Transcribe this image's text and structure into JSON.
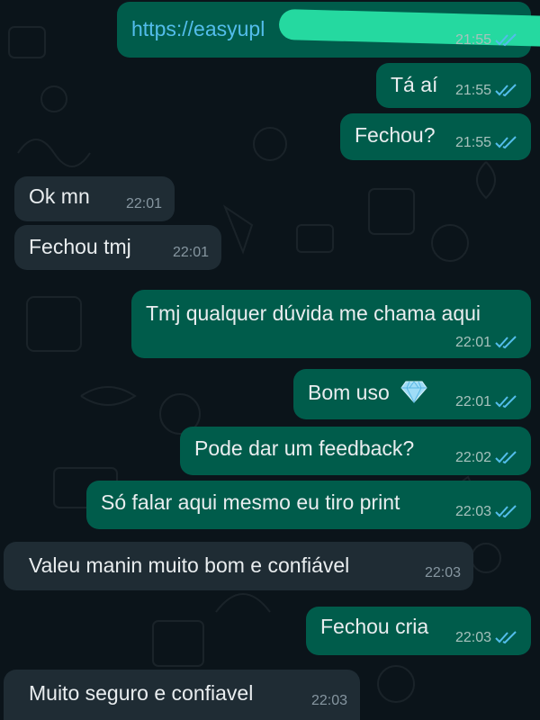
{
  "chat": {
    "messages": [
      {
        "direction": "outgoing",
        "text": "https://easyupl",
        "time": "21:55",
        "status": "read",
        "link": true,
        "redacted": true
      },
      {
        "direction": "outgoing",
        "text": "Tá aí",
        "time": "21:55",
        "status": "read"
      },
      {
        "direction": "outgoing",
        "text": "Fechou?",
        "time": "21:55",
        "status": "read"
      },
      {
        "direction": "incoming",
        "text": "Ok mn",
        "time": "22:01"
      },
      {
        "direction": "incoming",
        "text": "Fechou tmj",
        "time": "22:01"
      },
      {
        "direction": "outgoing",
        "text": "Tmj qualquer dúvida me chama aqui",
        "time": "22:01",
        "status": "read"
      },
      {
        "direction": "outgoing",
        "text": "Bom uso",
        "time": "22:01",
        "status": "read",
        "emoji": "gem-icon"
      },
      {
        "direction": "outgoing",
        "text": "Pode dar um feedback?",
        "time": "22:02",
        "status": "read"
      },
      {
        "direction": "outgoing",
        "text": "Só falar aqui mesmo eu tiro print",
        "time": "22:03",
        "status": "read"
      },
      {
        "direction": "incoming",
        "text": "Valeu manin muito bom e confiável",
        "time": "22:03"
      },
      {
        "direction": "outgoing",
        "text": "Fechou cria",
        "time": "22:03",
        "status": "read"
      },
      {
        "direction": "incoming",
        "text": "Muito seguro e confiavel",
        "time": "22:03"
      }
    ]
  },
  "colors": {
    "background": "#0b141a",
    "outgoing_bubble": "#005c4b",
    "incoming_bubble": "#1f2c34",
    "read_ticks": "#53bdeb",
    "link": "#53bdeb",
    "redaction": "#25d9a0"
  }
}
